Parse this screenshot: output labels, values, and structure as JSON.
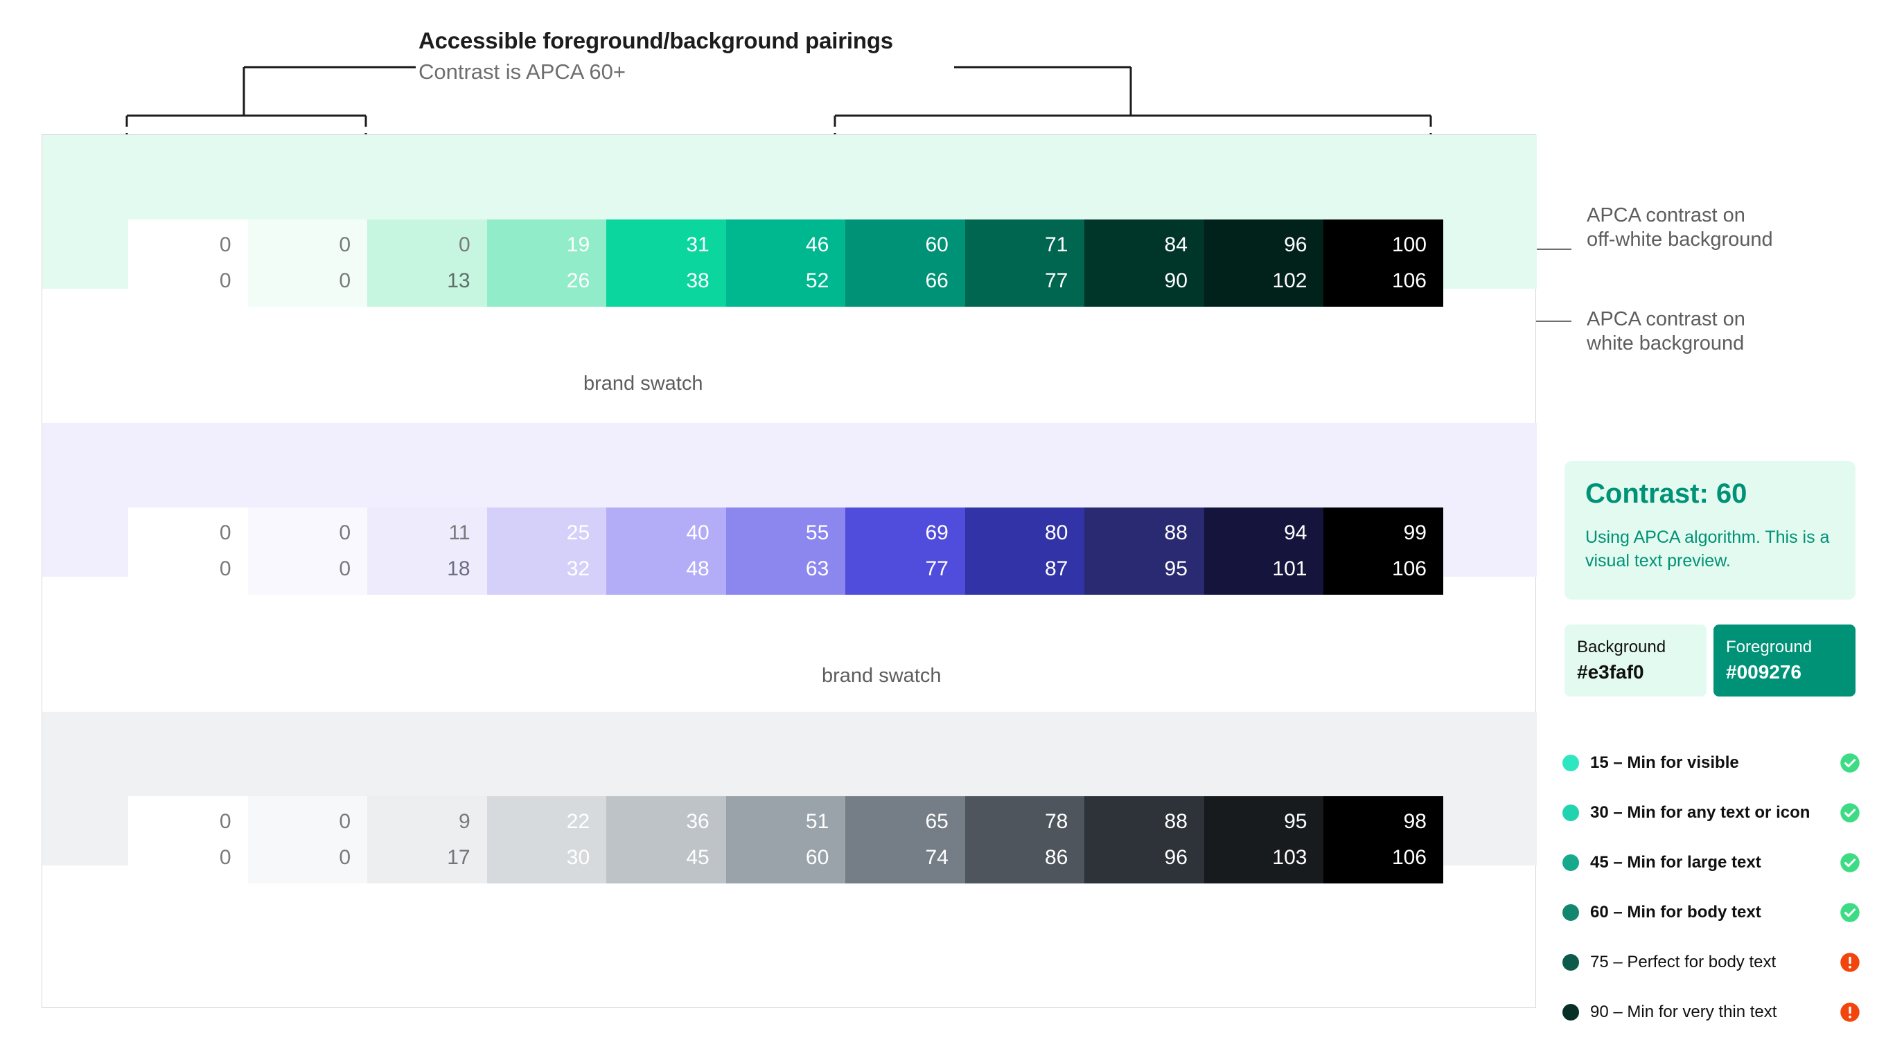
{
  "header": {
    "title": "Accessible foreground/background pairings",
    "subtitle": "Contrast is APCA 60+"
  },
  "annotations": {
    "off_white_line1": "APCA contrast on",
    "off_white_line2": "off-white background",
    "white_line1": "APCA contrast on",
    "white_line2": "white background",
    "brand_swatch_green": "brand swatch",
    "brand_swatch_purple": "brand swatch"
  },
  "preview": {
    "title": "Contrast: 60",
    "body": "Using APCA algorithm. This is a visual text preview.",
    "bg_color": "#e3faf0",
    "fg_color": "#009276"
  },
  "chips": [
    {
      "key": "Background",
      "value": "#e3faf0",
      "swatch": "#e3faf0",
      "text": "#101010"
    },
    {
      "key": "Foreground",
      "value": "#009276",
      "swatch": "#009276",
      "text": "#ffffff"
    }
  ],
  "legend": [
    {
      "label": "15 – Min for visible",
      "dot": "#2ee6c0",
      "status": "pass",
      "emphasis": true
    },
    {
      "label": "30 – Min for any text or icon",
      "dot": "#22d3b0",
      "status": "pass",
      "emphasis": true
    },
    {
      "label": "45 – Min for large text",
      "dot": "#17a98c",
      "status": "pass",
      "emphasis": true
    },
    {
      "label": "60 – Min for body text",
      "dot": "#13866f",
      "status": "pass",
      "emphasis": true
    },
    {
      "label": "75 – Perfect for body text",
      "dot": "#0b5a4a",
      "status": "fail",
      "emphasis": false
    },
    {
      "label": "90 – Min for very thin text",
      "dot": "#062f27",
      "status": "fail",
      "emphasis": false
    }
  ],
  "status_colors": {
    "pass": "#3ddc84",
    "fail": "#f2450d"
  },
  "chart_data": {
    "type": "heatmap",
    "title": "Accessible foreground/background pairings",
    "subtitle": "Contrast is APCA 60+",
    "row_labels": [
      "APCA contrast on off-white background",
      "APCA contrast on white background"
    ],
    "ramps": [
      {
        "name": "green",
        "band_tint": "#e3faf0",
        "brand_swatch_index": 4,
        "brand_swatch_label": "brand swatch",
        "swatches": [
          "#ffffff",
          "#f2fdf8",
          "#c6f5e0",
          "#90ecc9",
          "#0ad69e",
          "#00b88f",
          "#009276",
          "#00664f",
          "#00352a",
          "#01211b",
          "#000000"
        ],
        "off_white": [
          0,
          0,
          0,
          19,
          31,
          46,
          60,
          71,
          84,
          96,
          100
        ],
        "white": [
          0,
          0,
          13,
          26,
          38,
          52,
          66,
          77,
          90,
          102,
          106
        ],
        "text_colors_off_white": [
          "#7a7a7a",
          "#7a7a7a",
          "#7a7a7a",
          "#ffffff",
          "#ffffff",
          "#ffffff",
          "#ffffff",
          "#ffffff",
          "#ffffff",
          "#ffffff",
          "#ffffff"
        ],
        "text_colors_white": [
          "#7a7a7a",
          "#7a7a7a",
          "#5f6f69",
          "#ffffff",
          "#ffffff",
          "#ffffff",
          "#ffffff",
          "#ffffff",
          "#ffffff",
          "#ffffff",
          "#ffffff"
        ]
      },
      {
        "name": "purple",
        "band_tint": "#f1effd",
        "brand_swatch_index": 6,
        "brand_swatch_label": "brand swatch",
        "swatches": [
          "#ffffff",
          "#f9f8fe",
          "#eeebfc",
          "#d5d0fa",
          "#b3acf7",
          "#8c86ef",
          "#514ddc",
          "#3333a8",
          "#2a2a72",
          "#14143c",
          "#000000"
        ],
        "off_white": [
          0,
          0,
          11,
          25,
          40,
          55,
          69,
          80,
          88,
          94,
          99
        ],
        "white": [
          0,
          0,
          18,
          32,
          48,
          63,
          77,
          87,
          95,
          101,
          106
        ],
        "text_colors_off_white": [
          "#7a7a7a",
          "#7a7a7a",
          "#7a7a7a",
          "#ffffff",
          "#ffffff",
          "#ffffff",
          "#ffffff",
          "#ffffff",
          "#ffffff",
          "#ffffff",
          "#ffffff"
        ],
        "text_colors_white": [
          "#7a7a7a",
          "#7a7a7a",
          "#6d6d83",
          "#ffffff",
          "#ffffff",
          "#ffffff",
          "#ffffff",
          "#ffffff",
          "#ffffff",
          "#ffffff",
          "#ffffff"
        ]
      },
      {
        "name": "gray",
        "band_tint": "#f0f1f3",
        "brand_swatch_index": null,
        "brand_swatch_label": "",
        "swatches": [
          "#ffffff",
          "#f7f8f9",
          "#eceef0",
          "#d7dadd",
          "#bdc3c7",
          "#9aa2aa",
          "#757d86",
          "#4e555c",
          "#2d3338",
          "#181b1e",
          "#000000"
        ],
        "off_white": [
          0,
          0,
          9,
          22,
          36,
          51,
          65,
          78,
          88,
          95,
          98
        ],
        "white": [
          0,
          0,
          17,
          30,
          45,
          60,
          74,
          86,
          96,
          103,
          106
        ],
        "text_colors_off_white": [
          "#7a7a7a",
          "#7a7a7a",
          "#7a7a7a",
          "#ffffff",
          "#ffffff",
          "#ffffff",
          "#ffffff",
          "#ffffff",
          "#ffffff",
          "#ffffff",
          "#ffffff"
        ],
        "text_colors_white": [
          "#7a7a7a",
          "#7a7a7a",
          "#70767c",
          "#ffffff",
          "#ffffff",
          "#ffffff",
          "#ffffff",
          "#ffffff",
          "#ffffff",
          "#ffffff",
          "#ffffff"
        ]
      }
    ]
  }
}
